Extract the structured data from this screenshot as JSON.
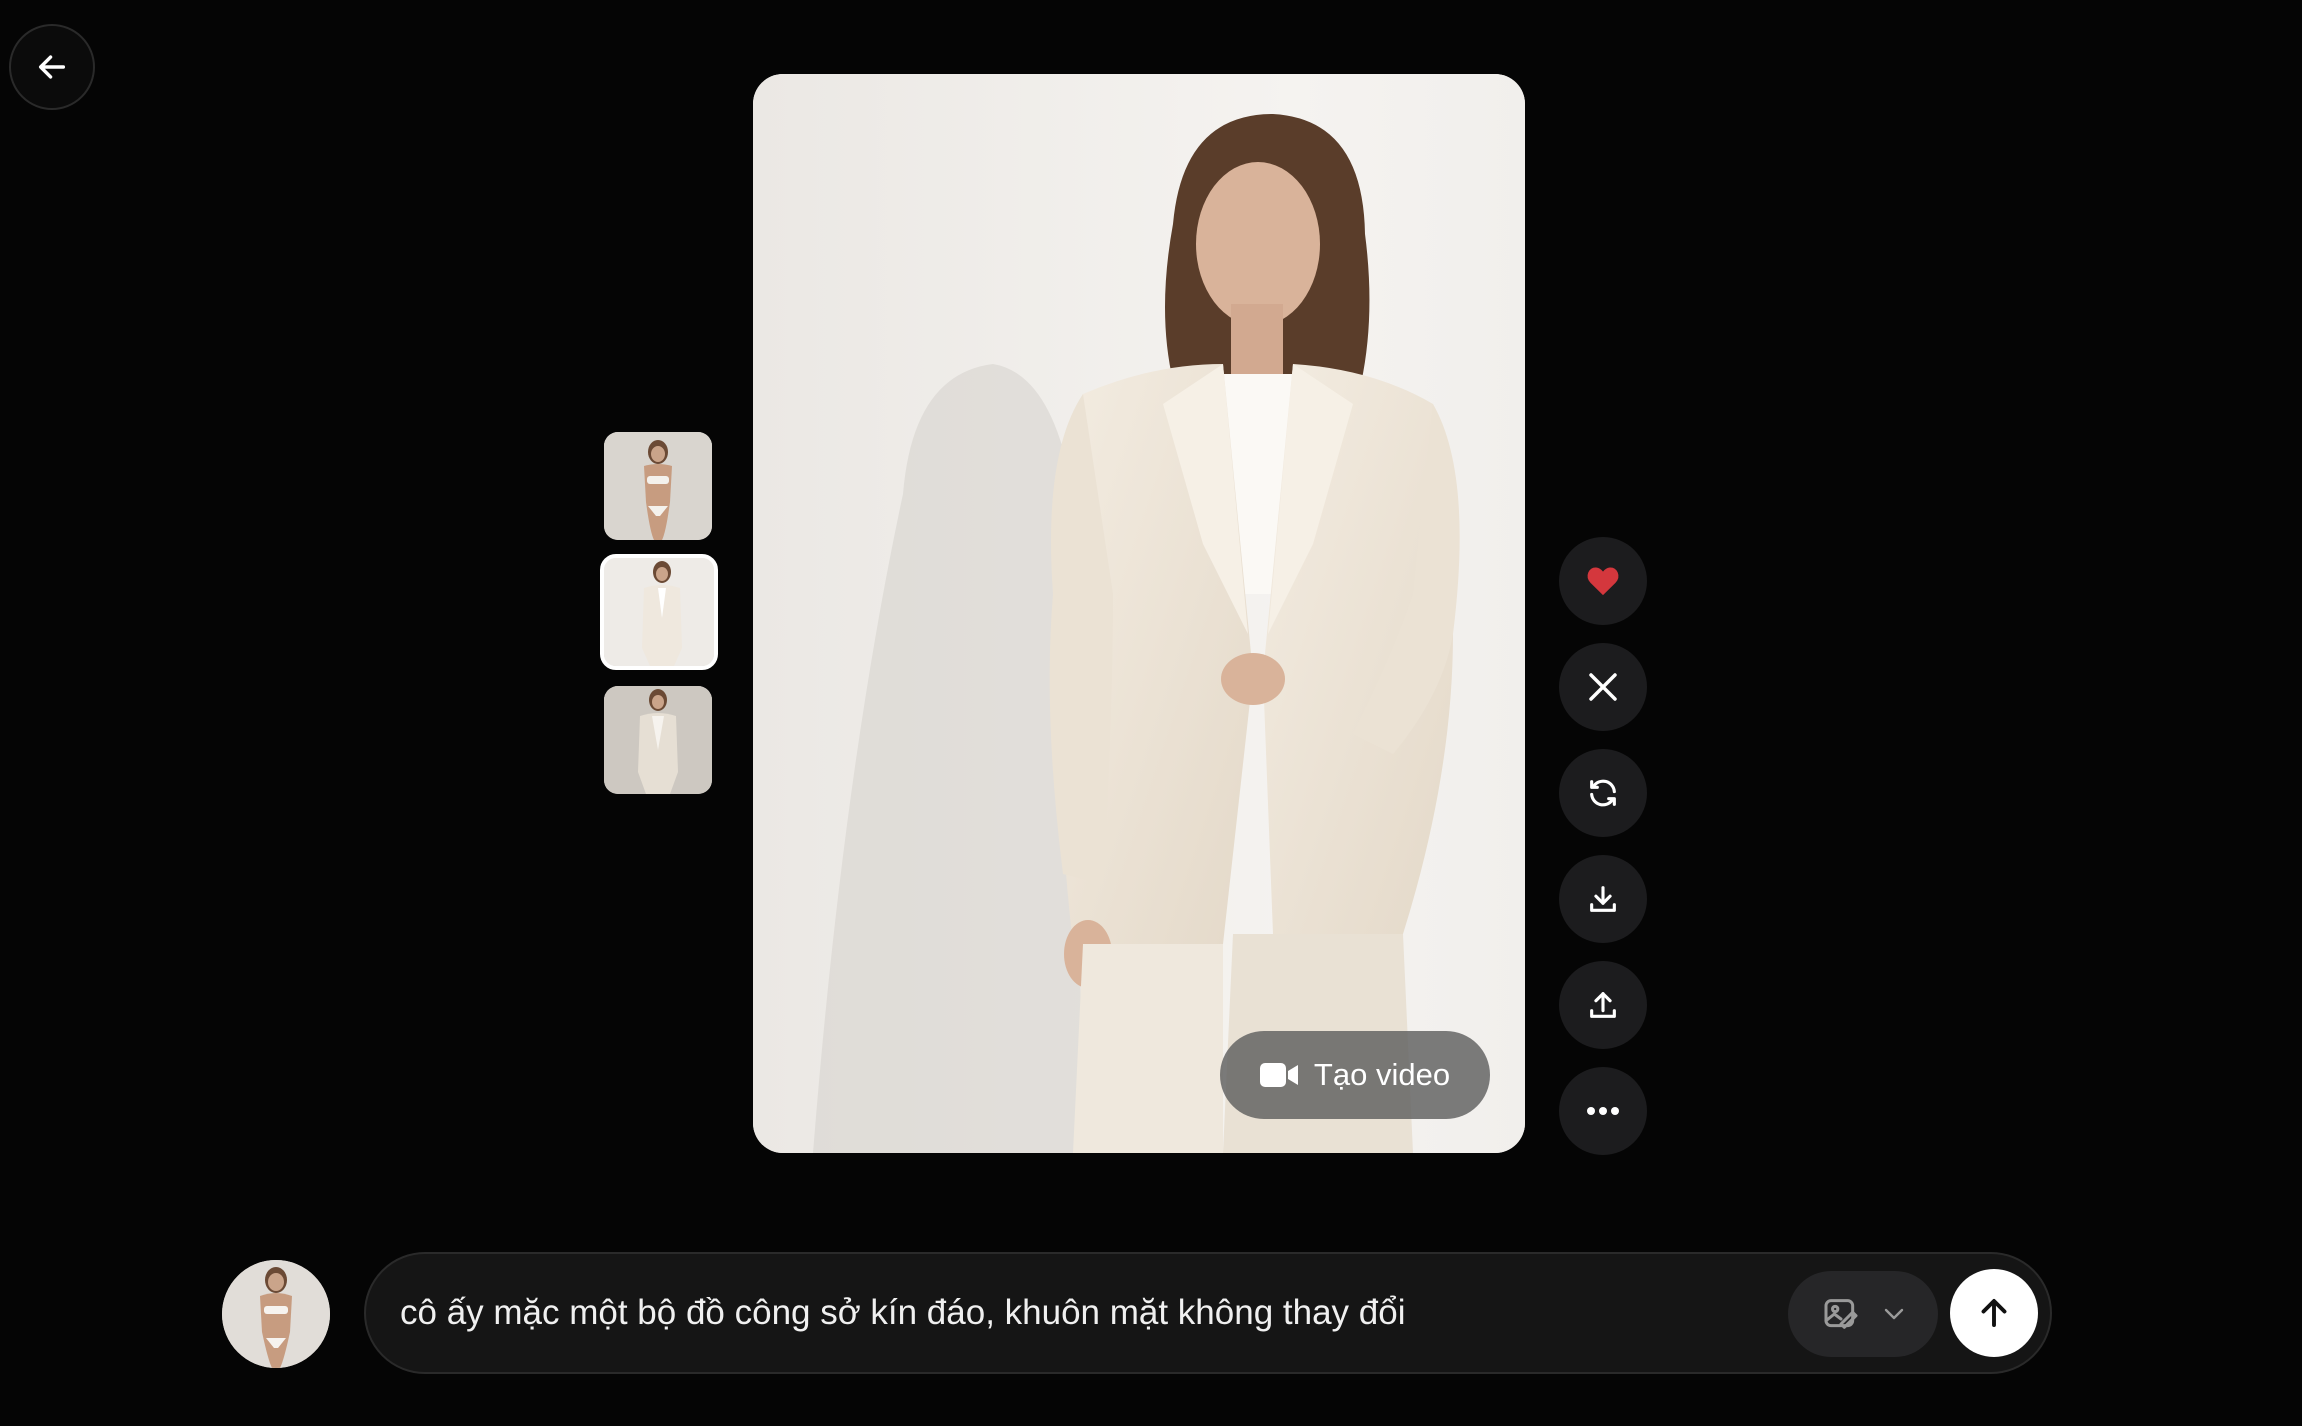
{
  "navigation": {
    "back_icon": "arrow-left-icon"
  },
  "thumbnails": [
    {
      "name": "thumbnail-1",
      "selected": false
    },
    {
      "name": "thumbnail-2",
      "selected": true
    },
    {
      "name": "thumbnail-3",
      "selected": false
    }
  ],
  "viewer": {
    "video_button_label": "Tạo video",
    "video_icon": "video-camera-icon"
  },
  "actions": [
    {
      "name": "like-button",
      "icon": "heart-icon",
      "active": true,
      "color": "#d4373d"
    },
    {
      "name": "share-x-button",
      "icon": "x-logo-icon"
    },
    {
      "name": "regenerate-button",
      "icon": "refresh-icon"
    },
    {
      "name": "download-button",
      "icon": "download-icon"
    },
    {
      "name": "upload-button",
      "icon": "upload-icon"
    },
    {
      "name": "more-button",
      "icon": "more-horizontal-icon"
    }
  ],
  "prompt": {
    "text": "cô ấy mặc một bộ đồ công sở kín đáo, khuôn mặt không thay đổi",
    "style_icon": "image-edit-icon",
    "submit_icon": "arrow-up-icon"
  },
  "colors": {
    "background": "#050505",
    "button": "#1c1c1e",
    "heart": "#d4373d",
    "submit": "#ffffff"
  }
}
